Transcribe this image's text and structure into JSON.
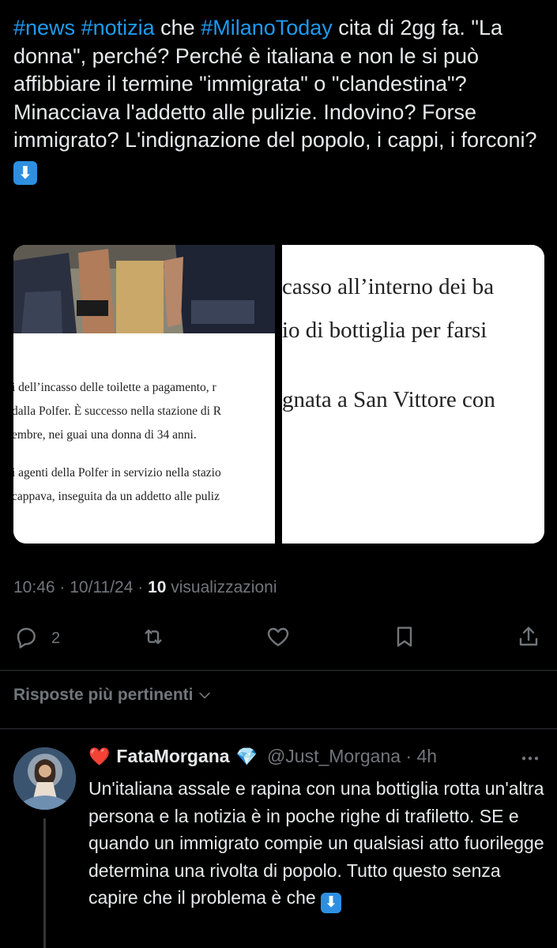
{
  "tweet": {
    "hashtag_news": "#news",
    "hashtag_notizia": "#notizia",
    "text_1": " che ",
    "hashtag_milano": "#MilanoToday",
    "text_2": " cita di 2gg fa. \"La donna\", perché? Perché è italiana e non le si può affibbiare il termine \"immigrata\" o \"clandestina\"? Minacciava l'addetto alle pulizie. Indovino? Forse immigrato? L'indignazione del popolo, i cappi, i forconi? ",
    "emoji": "⬇"
  },
  "media": {
    "left_lines": [
      "i dell’incasso delle toilette a pagamento, r",
      "dalla Polfer. È successo nella stazione di R",
      "embre, nei guai una donna di 34 anni.",
      "i agenti della Polfer in servizio nella stazio",
      "cappava, inseguita da un addetto alle puliz"
    ],
    "right_lines": [
      "casso all’interno dei ba",
      "io di bottiglia per farsi",
      "gnata a San Vittore con"
    ]
  },
  "meta": {
    "time_date": "10:46 · 10/11/24 · ",
    "views_count": "10",
    "views_label": " visualizzazioni"
  },
  "actions": {
    "reply_count": "2",
    "icons": [
      "reply-icon",
      "retweet-icon",
      "like-icon",
      "bookmark-icon",
      "share-icon"
    ]
  },
  "sort": {
    "label": "Risposte più pertinenti"
  },
  "reply": {
    "heart": "❤️",
    "name": "FataMorgana",
    "diamond": "💎",
    "handle_time": "@Just_Morgana · 4h",
    "text": "Un'italiana assale e rapina con una bottiglia rotta un'altra persona e la notizia è in poche righe di trafiletto. SE e quando un immigrato compie un qualsiasi atto fuorilegge determina una rivolta di popolo. Tutto questo senza capire che il problema è che ",
    "emoji": "⬇"
  },
  "colors": {
    "background": "#000000",
    "text": "#e7e9ea",
    "link": "#1d9bf0",
    "muted": "#71767b",
    "separator": "#2f3336"
  }
}
